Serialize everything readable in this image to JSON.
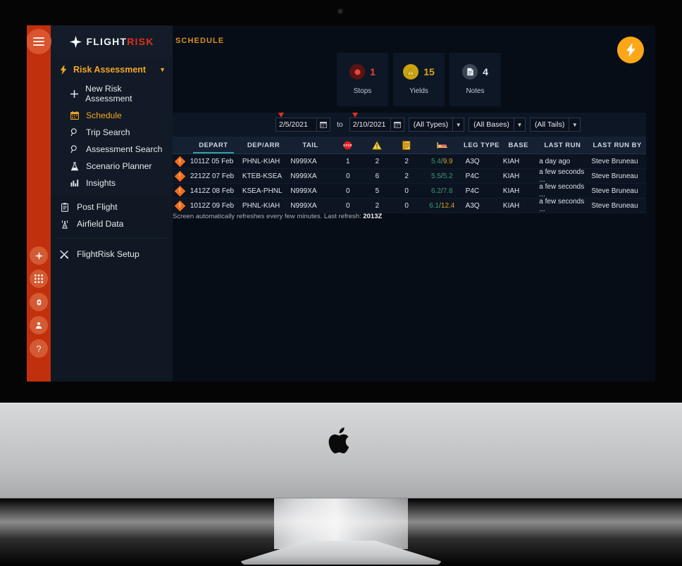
{
  "brand": {
    "name_a": "FLIGHT",
    "name_b": "RISK",
    "logo_icon": "four-point-star-icon"
  },
  "rail": {
    "menu_icon": "hamburger-icon",
    "buttons": [
      {
        "icon": "star-burst-icon",
        "glyph": "✦"
      },
      {
        "icon": "grid-apps-icon",
        "glyph": "▦"
      },
      {
        "icon": "gear-icon",
        "glyph": "✷"
      },
      {
        "icon": "user-icon",
        "glyph": "👤"
      },
      {
        "icon": "help-icon",
        "glyph": "?"
      }
    ]
  },
  "sidebar": {
    "section": {
      "label": "Risk Assessment",
      "icon": "lightning-bolt-icon",
      "caret": "▼"
    },
    "items": [
      {
        "label": "New Risk Assessment",
        "icon": "plus-icon",
        "glyph": "+",
        "active": false
      },
      {
        "label": "Schedule",
        "icon": "calendar-icon",
        "glyph": "▦",
        "active": true
      },
      {
        "label": "Trip Search",
        "icon": "magnifier-icon",
        "glyph": "⌕",
        "active": false
      },
      {
        "label": "Assessment Search",
        "icon": "magnifier-icon",
        "glyph": "⌕",
        "active": false
      },
      {
        "label": "Scenario Planner",
        "icon": "flask-icon",
        "glyph": "⌂",
        "active": false
      },
      {
        "label": "Insights",
        "icon": "bar-chart-icon",
        "glyph": "▥",
        "active": false
      }
    ],
    "items2": [
      {
        "label": "Post Flight",
        "icon": "clipboard-icon",
        "glyph": "▤"
      },
      {
        "label": "Airfield Data",
        "icon": "radio-tower-icon",
        "glyph": "⌖"
      }
    ],
    "items3": [
      {
        "label": "FlightRisk Setup",
        "icon": "tools-icon",
        "glyph": "✕"
      }
    ]
  },
  "header": {
    "page_title": "SCHEDULE",
    "flash_button_icon": "lightning-bolt-icon",
    "accent": "#fba719"
  },
  "stats": [
    {
      "label": "Stops",
      "value": "1",
      "icon": "stop-circle-icon",
      "badge_bg": "#5a1414",
      "dot": "#e8453c",
      "num_color": "#e8453c"
    },
    {
      "label": "Yields",
      "value": "15",
      "icon": "warning-triangle-icon",
      "badge_bg": "#c9a310",
      "dot": "#ffffff",
      "num_color": "#d6a81a"
    },
    {
      "label": "Notes",
      "value": "4",
      "icon": "document-icon",
      "badge_bg": "#3c4553",
      "dot": "#ffffff",
      "num_color": "#dfe4ea"
    }
  ],
  "filters": {
    "date_from": "2/5/2021",
    "date_to": "2/10/2021",
    "to_label": "to",
    "calendar_icon": "calendar-icon",
    "calendar_glyph": "▦",
    "caret_glyph": "▼",
    "selects": [
      {
        "name": "types",
        "value": "(All Types)"
      },
      {
        "name": "bases",
        "value": "(All Bases)"
      },
      {
        "name": "tails",
        "value": "(All Tails)"
      }
    ]
  },
  "table": {
    "columns": [
      {
        "key": "flag",
        "label": "",
        "icon": "risk-diamond-icon",
        "cls": "c-flag",
        "sorted": false
      },
      {
        "key": "depart",
        "label": "DEPART",
        "icon": "",
        "cls": "c-depart",
        "sorted": true
      },
      {
        "key": "deparr",
        "label": "DEP/ARR",
        "icon": "",
        "cls": "c-deparr",
        "sorted": false
      },
      {
        "key": "tail",
        "label": "TAIL",
        "icon": "",
        "cls": "c-tail",
        "sorted": false
      },
      {
        "key": "stops",
        "label": "",
        "icon": "stop-sign-icon",
        "cls": "c-stop",
        "sorted": false
      },
      {
        "key": "yields",
        "label": "",
        "icon": "warning-triangle-icon",
        "cls": "c-yield",
        "sorted": false
      },
      {
        "key": "notes",
        "label": "",
        "icon": "notes-icon",
        "cls": "c-note",
        "sorted": false
      },
      {
        "key": "rest",
        "label": "",
        "icon": "bed-icon",
        "cls": "c-rest",
        "sorted": false
      },
      {
        "key": "legtype",
        "label": "LEG TYPE",
        "icon": "",
        "cls": "c-leg",
        "sorted": false
      },
      {
        "key": "base",
        "label": "BASE",
        "icon": "",
        "cls": "c-base",
        "sorted": false
      },
      {
        "key": "lastrun",
        "label": "LAST RUN",
        "icon": "",
        "cls": "c-lastrun",
        "sorted": false
      },
      {
        "key": "runby",
        "label": "LAST RUN BY",
        "icon": "",
        "cls": "c-runby",
        "sorted": false
      }
    ],
    "rows": [
      {
        "flag": "!",
        "depart": "1011Z 05 Feb",
        "deparr": "PHNL-KIAH",
        "tail": "N999XA",
        "stops": "1",
        "yields": "2",
        "notes": "2",
        "rest_a": "5.4",
        "rest_b": "9.9",
        "rest_a_color": "#2f9e6b",
        "rest_b_color": "#d6a41a",
        "legtype": "A3Q",
        "base": "KIAH",
        "lastrun": "a day ago",
        "runby": "Steve Bruneau"
      },
      {
        "flag": "!",
        "depart": "2212Z 07 Feb",
        "deparr": "KTEB-KSEA",
        "tail": "N999XA",
        "stops": "0",
        "yields": "6",
        "notes": "2",
        "rest_a": "5.5",
        "rest_b": "5.2",
        "rest_a_color": "#2f9e6b",
        "rest_b_color": "#2f9e6b",
        "legtype": "P4C",
        "base": "KIAH",
        "lastrun": "a few seconds ...",
        "runby": "Steve Bruneau"
      },
      {
        "flag": "!",
        "depart": "1412Z 08 Feb",
        "deparr": "KSEA-PHNL",
        "tail": "N999XA",
        "stops": "0",
        "yields": "5",
        "notes": "0",
        "rest_a": "6.2",
        "rest_b": "7.8",
        "rest_a_color": "#2f9e6b",
        "rest_b_color": "#2f9e6b",
        "legtype": "P4C",
        "base": "KIAH",
        "lastrun": "a few seconds ...",
        "runby": "Steve Bruneau"
      },
      {
        "flag": "!",
        "depart": "1012Z 09 Feb",
        "deparr": "PHNL-KIAH",
        "tail": "N999XA",
        "stops": "0",
        "yields": "2",
        "notes": "0",
        "rest_a": "6.1",
        "rest_b": "12.4",
        "rest_a_color": "#2f9e6b",
        "rest_b_color": "#d6a41a",
        "legtype": "A3Q",
        "base": "KIAH",
        "lastrun": "a few seconds ...",
        "runby": "Steve Bruneau"
      }
    ]
  },
  "footer": {
    "refresh_prefix": "Screen automatically refreshes every few minutes. Last refresh: ",
    "refresh_time": "2013Z"
  },
  "device": {
    "brand_logo": "apple-logo-icon",
    "camera": "webcam-dot-icon"
  }
}
